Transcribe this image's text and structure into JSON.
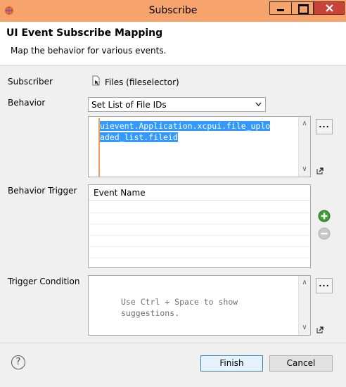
{
  "window": {
    "title": "Subscribe"
  },
  "header": {
    "title": "UI Event Subscribe Mapping",
    "subtitle": "Map the behavior for various events."
  },
  "subscriber": {
    "label": "Subscriber",
    "value": "Files (fileselector)"
  },
  "behavior": {
    "label": "Behavior",
    "selected": "Set List of File IDs",
    "expression_line1": "uievent.Application.xcpui.file_uplo",
    "expression_line2": "aded_list.fileid",
    "more_label": "..."
  },
  "behavior_trigger": {
    "label": "Behavior Trigger",
    "column_header": "Event Name"
  },
  "trigger_condition": {
    "label": "Trigger Condition",
    "hint_line1": "Use Ctrl + Space to show",
    "hint_line2": "suggestions.",
    "more_label": "..."
  },
  "footer": {
    "help": "?",
    "finish": "Finish",
    "cancel": "Cancel"
  },
  "colors": {
    "titlebar": "#f6a46b",
    "close": "#c7443a",
    "selection": "#3399ff",
    "add": "#3f9c35"
  }
}
